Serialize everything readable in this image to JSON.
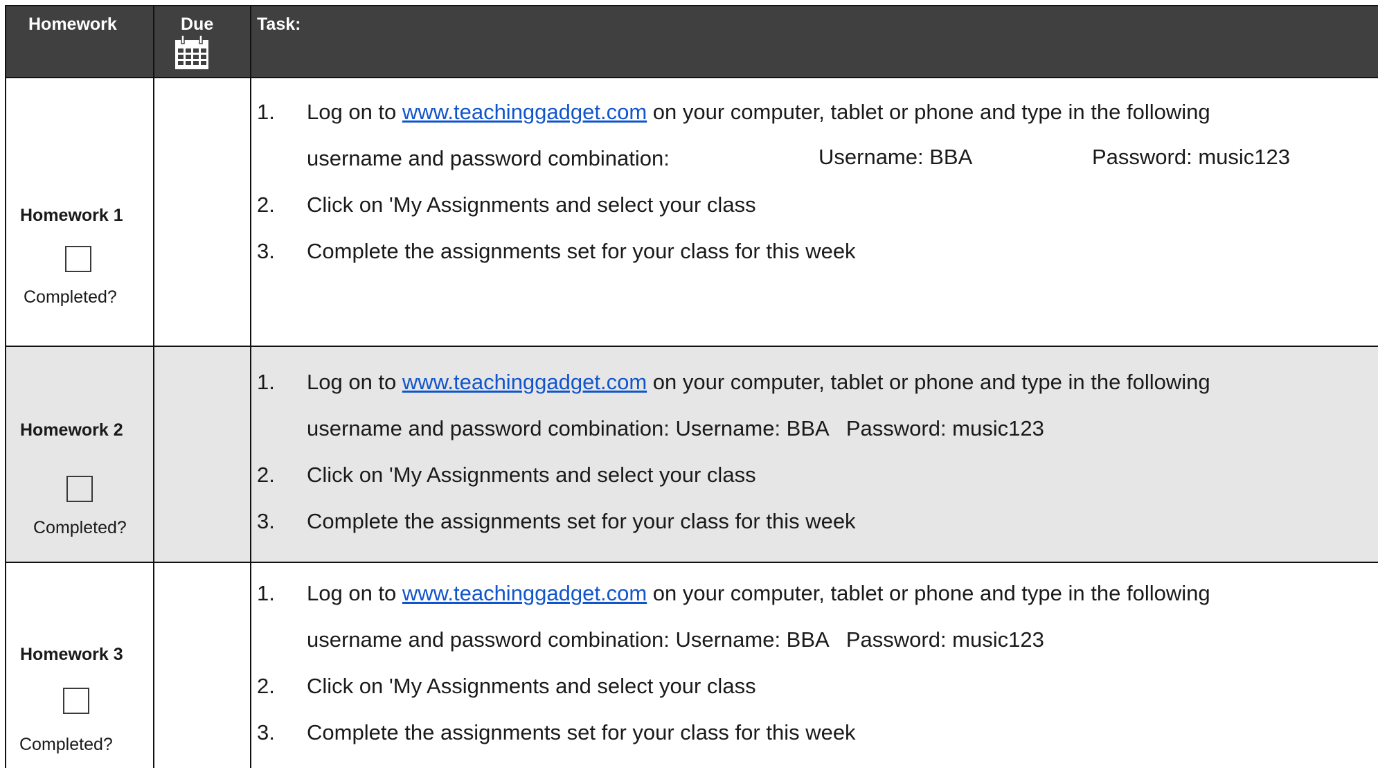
{
  "header": {
    "homework": "Homework",
    "due": "Due",
    "task": "Task:"
  },
  "icons": {
    "due": "calendar-icon"
  },
  "rows": [
    {
      "title": "Homework 1",
      "completed_label": "Completed?",
      "step1_num": "1.",
      "step1_pre": "Log on to ",
      "step1_link": "www.teachinggadget.com",
      "step1_post": " on your computer, tablet or phone and type in the following",
      "step1_cont": "username and password combination:",
      "username": "Username: BBA",
      "password": "Password: music123",
      "step2_num": "2.",
      "step2": "Click on 'My Assignments and select your class",
      "step3_num": "3.",
      "step3": "Complete the assignments set for your class for this week"
    },
    {
      "title": "Homework 2",
      "completed_label": "Completed?",
      "step1_num": "1.",
      "step1_pre": "Log on to ",
      "step1_link": "www.teachinggadget.com",
      "step1_post": " on your computer, tablet or phone and type in the following",
      "step1_cont": "username and password combination: Username: BBA   Password: music123",
      "step2_num": "2.",
      "step2": "Click on 'My Assignments and select your class",
      "step3_num": "3.",
      "step3": "Complete the assignments set for your class for this week"
    },
    {
      "title": "Homework 3",
      "completed_label": "Completed?",
      "step1_num": "1.",
      "step1_pre": "Log on to ",
      "step1_link": "www.teachinggadget.com",
      "step1_post": " on your computer, tablet or phone and type in the following",
      "step1_cont": "username and password combination: Username: BBA   Password: music123",
      "step2_num": "2.",
      "step2": "Click on 'My Assignments and select your class",
      "step3_num": "3.",
      "step3": "Complete the assignments set for your class for this week"
    }
  ],
  "colors": {
    "header_bg": "#404040",
    "shaded_row": "#e6e6e6",
    "link": "#1155cc"
  }
}
